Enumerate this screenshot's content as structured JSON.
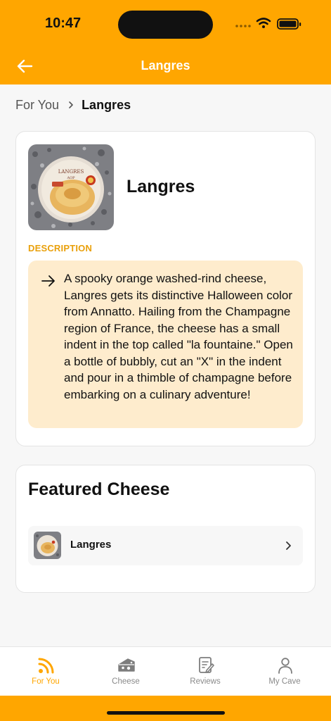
{
  "status_bar": {
    "time": "10:47"
  },
  "header": {
    "title": "Langres",
    "back_icon": "arrow-left-icon"
  },
  "breadcrumb": {
    "parent": "For You",
    "current": "Langres"
  },
  "cheese": {
    "name": "Langres",
    "description_label": "DESCRIPTION",
    "description": "A spooky orange washed-rind cheese, Langres gets its distinctive Halloween color from Annatto. Hailing from the Champagne region of France, the cheese has a small indent in the top called \"la fountaine.\" Open a bottle of bubbly, cut an \"X\" in the indent and pour in a thimble of champagne before embarking on a culinary adventure!"
  },
  "featured": {
    "title": "Featured Cheese",
    "items": [
      {
        "name": "Langres"
      }
    ]
  },
  "tabs": [
    {
      "label": "For You",
      "icon": "feed-icon",
      "active": true
    },
    {
      "label": "Cheese",
      "icon": "cheese-icon",
      "active": false
    },
    {
      "label": "Reviews",
      "icon": "reviews-icon",
      "active": false
    },
    {
      "label": "My Cave",
      "icon": "profile-icon",
      "active": false
    }
  ],
  "colors": {
    "accent": "#ffa600",
    "description_bg": "#feeccd",
    "label": "#e9a00b"
  }
}
